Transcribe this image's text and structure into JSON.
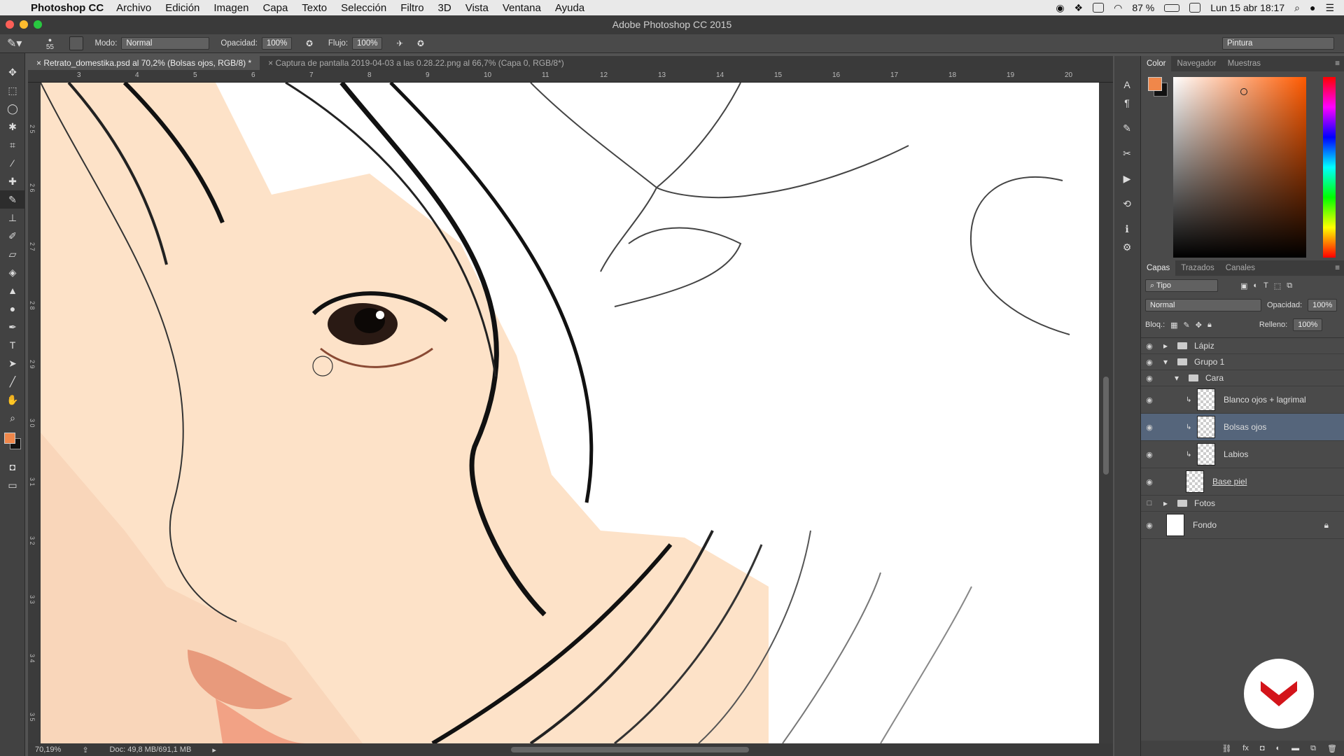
{
  "menubar": {
    "app": "Photoshop CC",
    "items": [
      "Archivo",
      "Edición",
      "Imagen",
      "Capa",
      "Texto",
      "Selección",
      "Filtro",
      "3D",
      "Vista",
      "Ventana",
      "Ayuda"
    ],
    "battery": "87 %",
    "clock": "Lun 15 abr  18:17"
  },
  "window": {
    "title": "Adobe Photoshop CC 2015"
  },
  "options": {
    "brush_size": "55",
    "mode_label": "Modo:",
    "mode_value": "Normal",
    "opacity_label": "Opacidad:",
    "opacity_value": "100%",
    "flow_label": "Flujo:",
    "flow_value": "100%",
    "workspace": "Pintura"
  },
  "tabs": [
    {
      "label": "Retrato_domestika.psd al 70,2% (Bolsas ojos, RGB/8) *"
    },
    {
      "label": "Captura de pantalla 2019-04-03 a las 0.28.22.png al 66,7% (Capa 0, RGB/8*)"
    }
  ],
  "ruler_top": [
    "3",
    "4",
    "5",
    "6",
    "7",
    "8",
    "9",
    "10",
    "11",
    "12",
    "13",
    "14",
    "15",
    "16",
    "17",
    "18",
    "19",
    "20"
  ],
  "ruler_left": [
    "2 5",
    "2 6",
    "2 7",
    "2 8",
    "2 9",
    "3 0",
    "3 1",
    "3 2",
    "3 3",
    "3 4",
    "3 5"
  ],
  "status": {
    "zoom": "70,19%",
    "doc": "Doc: 49,8 MB/691,1 MB"
  },
  "color_panel": {
    "tabs": [
      "Color",
      "Navegador",
      "Muestras"
    ],
    "fg": "#f0874a",
    "bg": "#111111"
  },
  "layers_panel": {
    "tabs": [
      "Capas",
      "Trazados",
      "Canales"
    ],
    "kind": "Tipo",
    "blend": "Normal",
    "opacity_label": "Opacidad:",
    "opacity_value": "100%",
    "lock_label": "Bloq.:",
    "fill_label": "Relleno:",
    "fill_value": "100%",
    "layers": [
      {
        "name": "Lápiz",
        "type": "group"
      },
      {
        "name": "Grupo 1",
        "type": "group"
      },
      {
        "name": "Cara",
        "type": "group"
      },
      {
        "name": "Blanco ojos + lagrimal",
        "type": "layer"
      },
      {
        "name": "Bolsas ojos",
        "type": "layer"
      },
      {
        "name": "Labios",
        "type": "layer"
      },
      {
        "name": "Base piel",
        "type": "layer"
      },
      {
        "name": "Fotos",
        "type": "group"
      },
      {
        "name": "Fondo",
        "type": "bg"
      }
    ]
  },
  "accent": "#55657b",
  "logo_color": "#d3141a"
}
